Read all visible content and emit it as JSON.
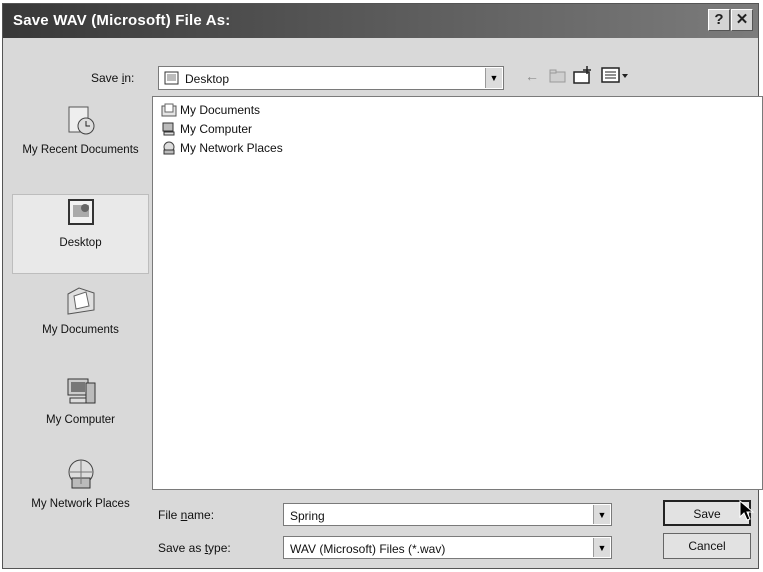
{
  "dialog": {
    "title": "Save WAV (Microsoft) File As:",
    "help_glyph": "?",
    "close_glyph": "✕"
  },
  "savein": {
    "label_prefix": "Save ",
    "label_accel": "i",
    "label_suffix": "n:",
    "value": "Desktop"
  },
  "places": [
    {
      "label": "My Recent Documents",
      "icon": "recent-documents-icon"
    },
    {
      "label": "Desktop",
      "icon": "desktop-icon"
    },
    {
      "label": "My Documents",
      "icon": "my-documents-icon"
    },
    {
      "label": "My Computer",
      "icon": "my-computer-icon"
    },
    {
      "label": "My Network Places",
      "icon": "network-places-icon"
    }
  ],
  "files": [
    {
      "name": "My Documents",
      "icon": "folder-documents-icon"
    },
    {
      "name": "My Computer",
      "icon": "computer-icon"
    },
    {
      "name": "My Network Places",
      "icon": "network-icon"
    }
  ],
  "filename": {
    "label_prefix": "File ",
    "label_accel": "n",
    "label_suffix": "ame:",
    "value": "Spring"
  },
  "savetype": {
    "label_prefix": "Save as ",
    "label_accel": "t",
    "label_suffix": "ype:",
    "value": "WAV (Microsoft) Files (*.wav)"
  },
  "buttons": {
    "save": "Save",
    "cancel": "Cancel"
  }
}
